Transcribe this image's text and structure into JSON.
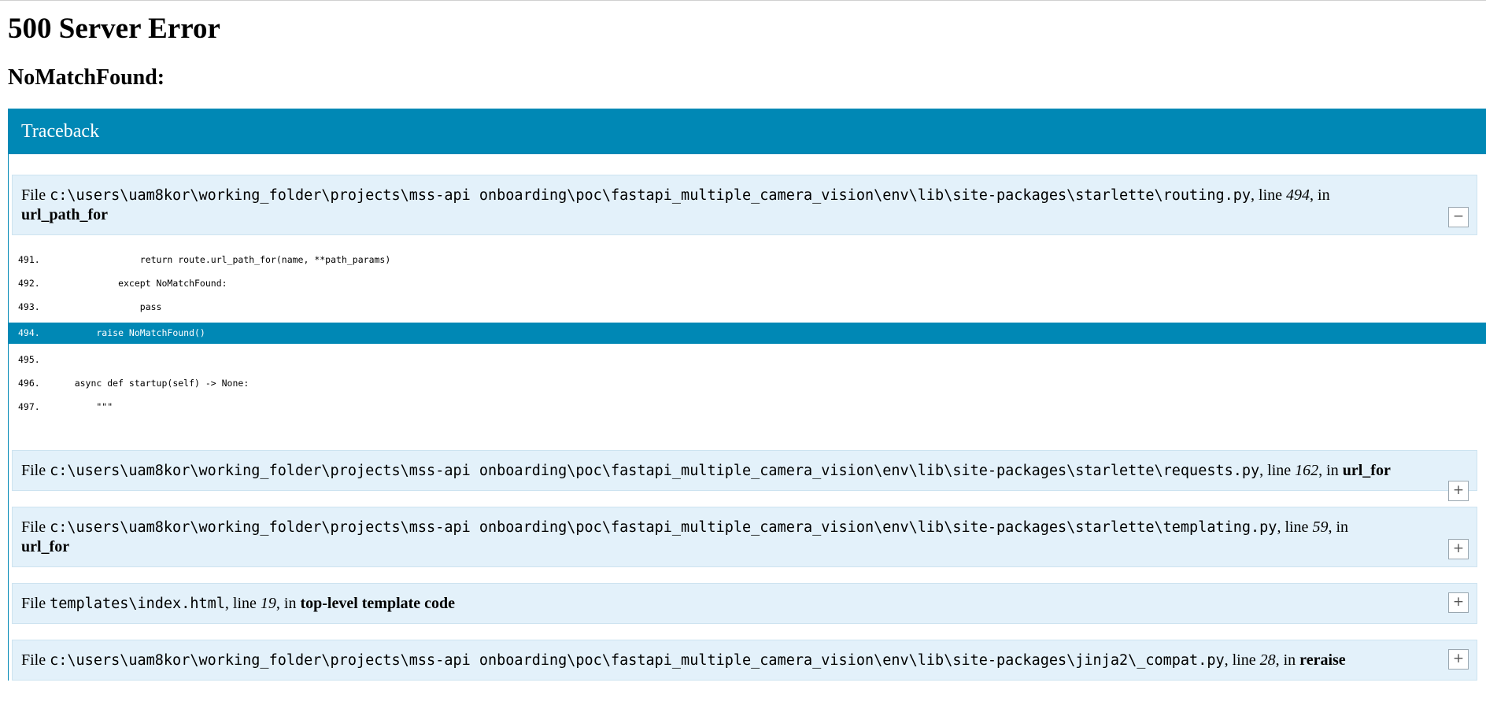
{
  "title": "500 Server Error",
  "error_name": "NoMatchFound:",
  "traceback_label": "Traceback",
  "frames": [
    {
      "file_prefix": "File ",
      "path": "c:\\users\\uam8kor\\working_folder\\projects\\mss-api onboarding\\poc\\fastapi_multiple_camera_vision\\env\\lib\\site-packages\\starlette\\routing.py",
      "line_prefix": ", line ",
      "line": "494",
      "in_prefix": ", in",
      "func": "url_path_for",
      "toggle": "−",
      "expanded": true,
      "code": [
        {
          "num": "491.",
          "text": "                return route.url_path_for(name, **path_params)"
        },
        {
          "num": "492.",
          "text": "            except NoMatchFound:"
        },
        {
          "num": "493.",
          "text": "                pass"
        },
        {
          "num": "494.",
          "text": "        raise NoMatchFound()"
        },
        {
          "num": "495.",
          "text": ""
        },
        {
          "num": "496.",
          "text": "    async def startup(self) -> None:"
        },
        {
          "num": "497.",
          "text": "        \"\"\""
        }
      ]
    },
    {
      "file_prefix": "File ",
      "path": "c:\\users\\uam8kor\\working_folder\\projects\\mss-api onboarding\\poc\\fastapi_multiple_camera_vision\\env\\lib\\site-packages\\starlette\\requests.py",
      "line_prefix": ", line ",
      "line": "162",
      "in_prefix": ", in ",
      "func": "url_for",
      "toggle": "+"
    },
    {
      "file_prefix": "File ",
      "path": "c:\\users\\uam8kor\\working_folder\\projects\\mss-api onboarding\\poc\\fastapi_multiple_camera_vision\\env\\lib\\site-packages\\starlette\\templating.py",
      "line_prefix": ", line ",
      "line": "59",
      "in_prefix": ", in",
      "func": "url_for",
      "toggle": "+"
    },
    {
      "file_prefix": "File ",
      "path": "templates\\index.html",
      "line_prefix": ", line ",
      "line": "19",
      "in_prefix": ", in ",
      "func": "top-level template code",
      "toggle": "+"
    },
    {
      "file_prefix": "File ",
      "path": "c:\\users\\uam8kor\\working_folder\\projects\\mss-api onboarding\\poc\\fastapi_multiple_camera_vision\\env\\lib\\site-packages\\jinja2\\_compat.py",
      "line_prefix": ", line ",
      "line": "28",
      "in_prefix": ", in ",
      "func": "reraise",
      "toggle": "+"
    }
  ],
  "colors": {
    "accent": "#0088b5",
    "frame_bg": "#e3f1fa"
  }
}
